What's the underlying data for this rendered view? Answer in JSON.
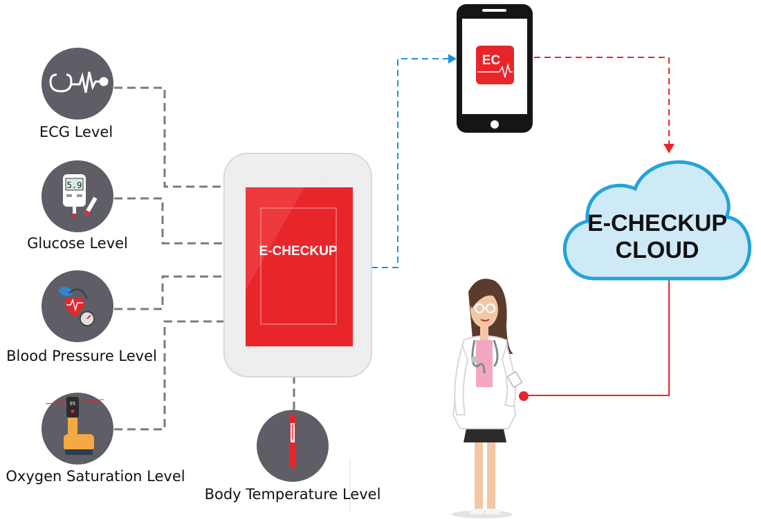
{
  "sensors": {
    "ecg": "ECG Level",
    "glucose": "Glucose Level",
    "blood_pressure": "Blood Pressure Level",
    "oxygen": "Oxygen Saturation Level",
    "temperature": "Body Temperature Level"
  },
  "device": {
    "label": "E-CHECKUP"
  },
  "phone": {
    "app_label": "EC"
  },
  "cloud": {
    "line1": "E-CHECKUP",
    "line2": "CLOUD"
  },
  "glucometer": {
    "reading": "5.9"
  },
  "oximeter": {
    "reading": "95"
  },
  "colors": {
    "sensor_circle": "#5f5d66",
    "device_red": "#e8262a",
    "device_frame": "#eeeeee",
    "sensor_link": "#7a7a7a",
    "phone_link": "#1e90d6",
    "cloud_link": "#e8262a",
    "cloud_fill": "#cfeaf7",
    "cloud_border": "#22a3db"
  },
  "icons": {
    "ecg": "stethoscope-icon",
    "glucose": "glucometer-icon",
    "blood_pressure": "blood-pressure-monitor-icon",
    "oxygen": "pulse-oximeter-icon",
    "temperature": "thermometer-icon",
    "doctor": "doctor-icon",
    "phone": "smartphone-icon",
    "cloud": "cloud-icon"
  }
}
